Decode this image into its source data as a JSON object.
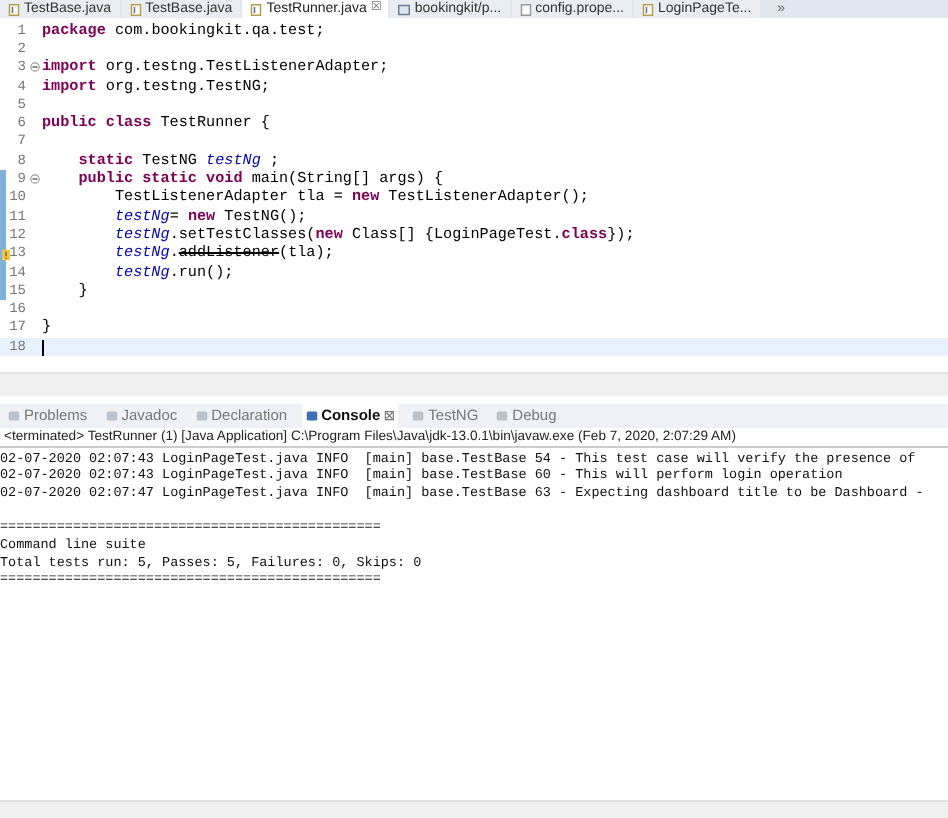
{
  "editor_tabs": [
    {
      "label": "TestBase.java",
      "selected": false,
      "kind": "java"
    },
    {
      "label": "TestBase.java",
      "selected": false,
      "kind": "java"
    },
    {
      "label": "TestRunner.java",
      "selected": true,
      "kind": "java",
      "close": "☒"
    },
    {
      "label": "bookingkit/p...",
      "selected": false,
      "kind": "xml"
    },
    {
      "label": "config.prope...",
      "selected": false,
      "kind": "file"
    },
    {
      "label": "LoginPageTe...",
      "selected": false,
      "kind": "java"
    }
  ],
  "overflow": "»",
  "code_lines": [
    {
      "number": "1",
      "segments": [
        {
          "kind": "keyword",
          "text": "package "
        },
        {
          "kind": "plain",
          "text": "com.bookingkit.qa.test;"
        }
      ]
    },
    {
      "number": "2"
    },
    {
      "number": "3",
      "fold": true,
      "segments": [
        {
          "kind": "keyword",
          "text": "import "
        },
        {
          "kind": "plain",
          "text": "org.testng.TestListenerAdapter;"
        }
      ]
    },
    {
      "number": "4",
      "segments": [
        {
          "kind": "keyword",
          "text": "import "
        },
        {
          "kind": "plain",
          "text": "org.testng.TestNG;"
        }
      ]
    },
    {
      "number": "5"
    },
    {
      "number": "6",
      "segments": [
        {
          "kind": "keyword",
          "text": "public class "
        },
        {
          "kind": "plain",
          "text": "TestRunner {"
        }
      ]
    },
    {
      "number": "7"
    },
    {
      "number": "8",
      "segments": [
        {
          "kind": "keyword",
          "text": "    static "
        },
        {
          "kind": "plain",
          "text": "TestNG "
        },
        {
          "kind": "field",
          "text": "testNg"
        },
        {
          "kind": "plain",
          "text": " ;"
        }
      ]
    },
    {
      "number": "9",
      "fold": true,
      "changed": true,
      "segments": [
        {
          "kind": "keyword",
          "text": "    public static void "
        },
        {
          "kind": "plain",
          "text": "main(String[] args) {"
        }
      ]
    },
    {
      "number": "10",
      "changed": true,
      "segments": [
        {
          "kind": "plain",
          "text": "        TestListenerAdapter tla = "
        },
        {
          "kind": "keyword",
          "text": "new"
        },
        {
          "kind": "plain",
          "text": " TestListenerAdapter();"
        }
      ]
    },
    {
      "number": "11",
      "changed": true,
      "segments": [
        {
          "kind": "field",
          "text": "        testNg"
        },
        {
          "kind": "plain",
          "text": "= "
        },
        {
          "kind": "keyword",
          "text": "new"
        },
        {
          "kind": "plain",
          "text": " TestNG();"
        }
      ]
    },
    {
      "number": "12",
      "changed": true,
      "segments": [
        {
          "kind": "field",
          "text": "        testNg"
        },
        {
          "kind": "plain",
          "text": ".setTestClasses("
        },
        {
          "kind": "keyword",
          "text": "new"
        },
        {
          "kind": "plain",
          "text": " Class[] {LoginPageTest."
        },
        {
          "kind": "keyword",
          "text": "class"
        },
        {
          "kind": "plain",
          "text": "});"
        }
      ]
    },
    {
      "number": "13",
      "changed": true,
      "warning": true,
      "segments": [
        {
          "kind": "field",
          "text": "        testNg"
        },
        {
          "kind": "plain",
          "text": "."
        },
        {
          "kind": "deprecated",
          "text": "addListener"
        },
        {
          "kind": "plain",
          "text": "(tla);"
        }
      ]
    },
    {
      "number": "14",
      "changed": true,
      "segments": [
        {
          "kind": "field",
          "text": "        testNg"
        },
        {
          "kind": "plain",
          "text": ".run();"
        }
      ]
    },
    {
      "number": "15",
      "changed": true,
      "segments": [
        {
          "kind": "plain",
          "text": "    }"
        }
      ]
    },
    {
      "number": "16"
    },
    {
      "number": "17",
      "segments": [
        {
          "kind": "plain",
          "text": "}"
        }
      ]
    },
    {
      "number": "18",
      "current": true
    }
  ],
  "view_tabs": [
    {
      "label": "Problems",
      "selected": false
    },
    {
      "label": "Javadoc",
      "selected": false
    },
    {
      "label": "Declaration",
      "selected": false
    },
    {
      "label": "Console",
      "selected": true,
      "close": "☒"
    },
    {
      "label": "TestNG",
      "selected": false
    },
    {
      "label": "Debug",
      "selected": false
    }
  ],
  "console_header": "<terminated> TestRunner (1) [Java Application] C:\\Program Files\\Java\\jdk-13.0.1\\bin\\javaw.exe (Feb 7, 2020, 2:07:29 AM)",
  "console_lines": [
    {
      "text": "02-07-2020 02:07:43 LoginPageTest.java INFO  [main] base.TestBase 54 - This test case will verify the presence of"
    },
    {
      "text": "02-07-2020 02:07:43 LoginPageTest.java INFO  [main] base.TestBase 60 - This will perform login operation"
    },
    {
      "text": "02-07-2020 02:07:47 LoginPageTest.java INFO  [main] base.TestBase 63 - Expecting dashboard title to be Dashboard -"
    },
    {
      "text": "===============================================",
      "blank_before": true
    },
    {
      "text": "Command line suite"
    },
    {
      "text": "Total tests run: 5, Passes: 5, Failures: 0, Skips: 0"
    },
    {
      "text": "==============================================="
    }
  ]
}
